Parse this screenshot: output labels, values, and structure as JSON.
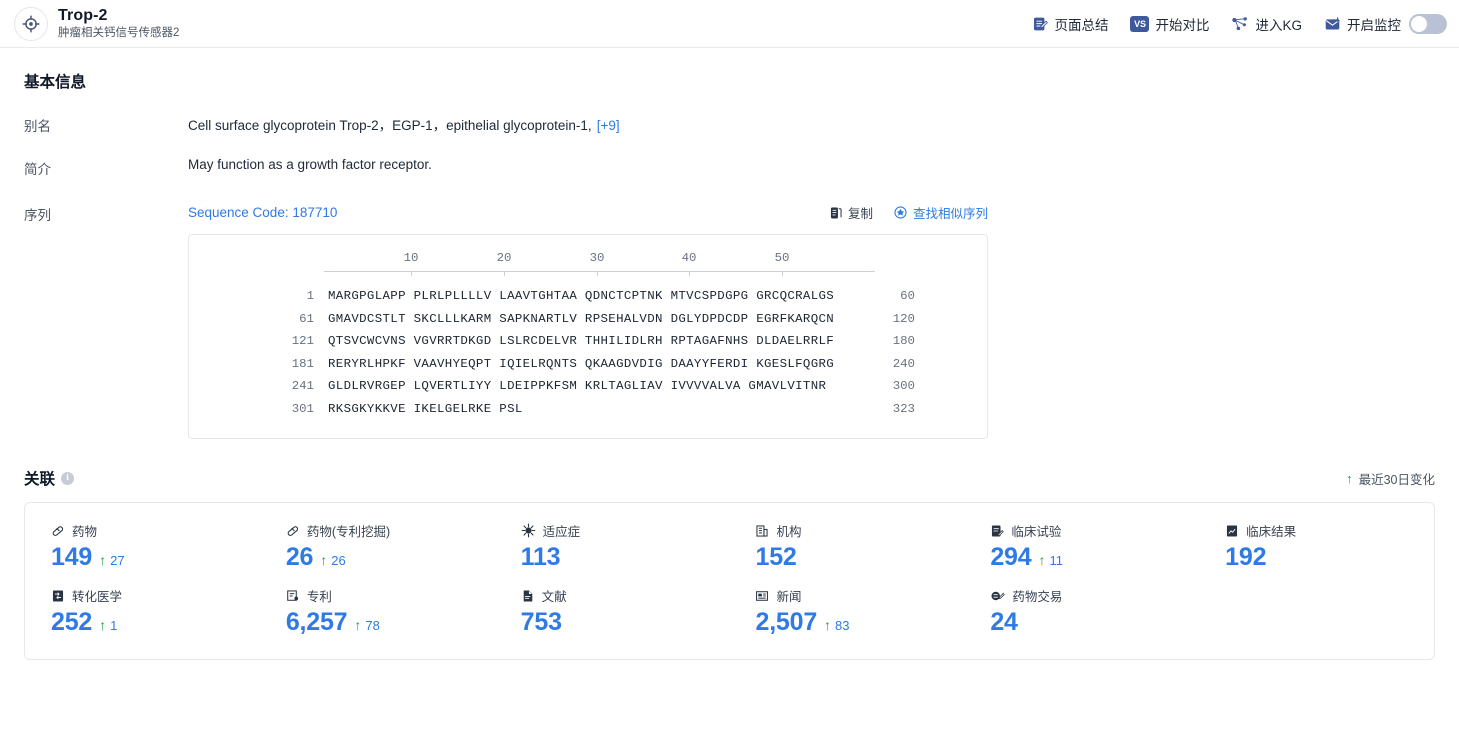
{
  "header": {
    "icon": "target-icon",
    "title": "Trop-2",
    "subtitle": "肿瘤相关钙信号传感器2",
    "actions": [
      {
        "label": "页面总结",
        "icon": "summary-pen-icon"
      },
      {
        "label": "开始对比",
        "icon": "vs-badge-icon",
        "badge": "VS"
      },
      {
        "label": "进入KG",
        "icon": "knowledge-graph-icon"
      },
      {
        "label": "开启监控",
        "icon": "monitor-icon",
        "toggle": "off"
      }
    ]
  },
  "basic_info": {
    "title": "基本信息",
    "rows": [
      {
        "label": "别名",
        "value": "Cell surface glycoprotein Trop-2，EGP-1，epithelial glycoprotein-1,",
        "more": "[+9]"
      },
      {
        "label": "简介",
        "value": "May function as a growth factor receptor."
      }
    ],
    "sequence": {
      "label": "序列",
      "code": "Sequence Code: 187710",
      "tools": [
        {
          "label": "复制",
          "icon": "copy-icon"
        },
        {
          "label": "查找相似序列",
          "icon": "similar-sequence-icon"
        }
      ],
      "ruler": [
        "10",
        "20",
        "30",
        "40",
        "50"
      ],
      "rows": [
        {
          "start": "1",
          "chunks": "MARGPGLAPP PLRLPLLLLV LAAVTGHTAA QDNCTCPTNK MTVCSPDGPG GRCQCRALGS",
          "end": "60"
        },
        {
          "start": "61",
          "chunks": "GMAVDCSTLT SKCLLLKARM SAPKNARTLV RPSEHALVDN DGLYDPDCDP EGRFKARQCN",
          "end": "120"
        },
        {
          "start": "121",
          "chunks": "QTSVCWCVNS VGVRRTDKGD LSLRCDELVR THHILIDLRH RPTAGAFNHS DLDAELRRLF",
          "end": "180"
        },
        {
          "start": "181",
          "chunks": "RERYRLHPKF VAAVHYEQPT IQIELRQNTS QKAAGDVDIG DAAYYFERDI KGESLFQGRG",
          "end": "240"
        },
        {
          "start": "241",
          "chunks": "GLDLRVRGEP LQVERTLIYY LDEIPPKFSM KRLTAGLIAV IVVVVALVA GMAVLVITNR",
          "end": "300"
        },
        {
          "start": "301",
          "chunks": "RKSGKYKKVE IKELGELRKE PSL",
          "end": "323"
        }
      ]
    }
  },
  "related": {
    "title": "关联",
    "info_icon": "info-icon",
    "legend": {
      "arrow": "↑",
      "label": "最近30日变化"
    },
    "stats": [
      {
        "label": "药物",
        "icon": "pill-icon",
        "value": "149",
        "delta": "27"
      },
      {
        "label": "药物(专利挖掘)",
        "icon": "pill-icon",
        "value": "26",
        "delta": "26"
      },
      {
        "label": "适应症",
        "icon": "virus-icon",
        "value": "113",
        "delta": null
      },
      {
        "label": "机构",
        "icon": "organization-icon",
        "value": "152",
        "delta": null
      },
      {
        "label": "临床试验",
        "icon": "clinical-trial-icon",
        "value": "294",
        "delta": "11"
      },
      {
        "label": "临床结果",
        "icon": "clinical-result-icon",
        "value": "192",
        "delta": null
      },
      {
        "label": "转化医学",
        "icon": "translational-icon",
        "value": "252",
        "delta": "1"
      },
      {
        "label": "专利",
        "icon": "patent-icon",
        "value": "6,257",
        "delta": "78"
      },
      {
        "label": "文献",
        "icon": "literature-icon",
        "value": "753",
        "delta": null
      },
      {
        "label": "新闻",
        "icon": "news-icon",
        "value": "2,507",
        "delta": "83"
      },
      {
        "label": "药物交易",
        "icon": "deal-icon",
        "value": "24",
        "delta": null
      }
    ]
  },
  "colors": {
    "accent_blue": "#2f7ae5",
    "delta_green": "#23a33c",
    "icon_navy": "#3f5a9c",
    "border": "#e6e8ec"
  }
}
